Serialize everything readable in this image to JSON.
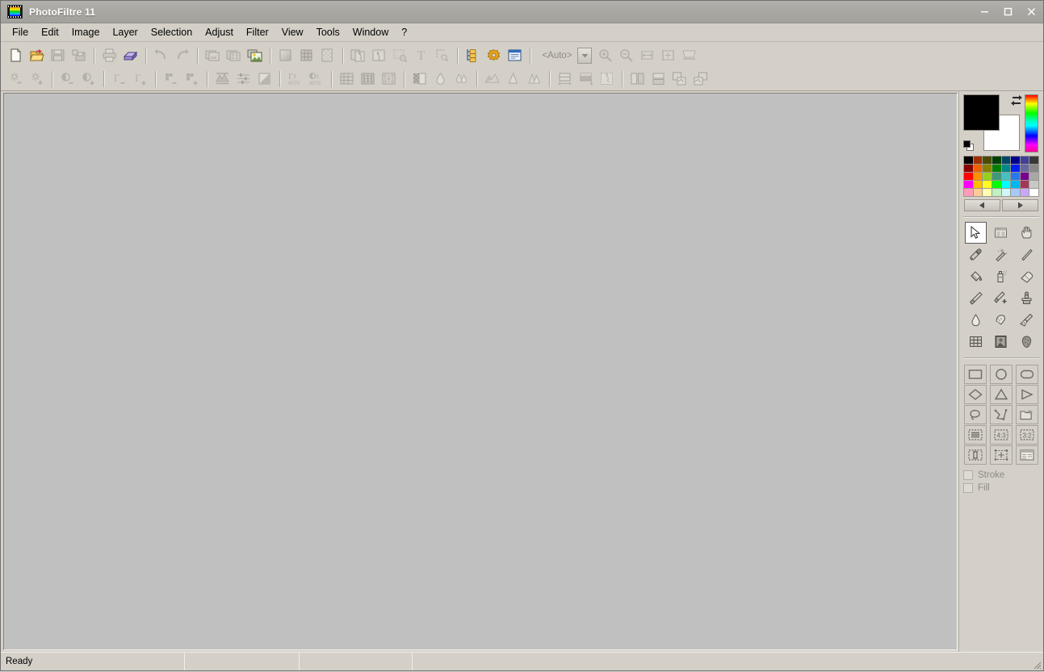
{
  "window": {
    "title": "PhotoFiltre 11",
    "app_icon": "filmstrip-icon",
    "minimize_label": "—",
    "maximize_label": "□",
    "close_label": "✕"
  },
  "menubar": {
    "items": [
      {
        "label": "File",
        "name": "menu-file"
      },
      {
        "label": "Edit",
        "name": "menu-edit"
      },
      {
        "label": "Image",
        "name": "menu-image"
      },
      {
        "label": "Layer",
        "name": "menu-layer"
      },
      {
        "label": "Selection",
        "name": "menu-selection"
      },
      {
        "label": "Adjust",
        "name": "menu-adjust"
      },
      {
        "label": "Filter",
        "name": "menu-filter"
      },
      {
        "label": "View",
        "name": "menu-view"
      },
      {
        "label": "Tools",
        "name": "menu-tools"
      },
      {
        "label": "Window",
        "name": "menu-window"
      },
      {
        "label": "?",
        "name": "menu-help"
      }
    ]
  },
  "toolbar_row1": {
    "zoom_value": "<Auto>",
    "buttons": [
      {
        "name": "new-icon",
        "title": "New",
        "enabled": true
      },
      {
        "name": "open-icon",
        "title": "Open",
        "enabled": true
      },
      {
        "name": "save-icon",
        "title": "Save",
        "enabled": false
      },
      {
        "name": "save-as-icon",
        "title": "Save As",
        "enabled": false
      },
      {
        "name": "sep"
      },
      {
        "name": "print-icon",
        "title": "Print",
        "enabled": false
      },
      {
        "name": "scanner-icon",
        "title": "Acquire / Scanner",
        "enabled": true
      },
      {
        "name": "sep"
      },
      {
        "name": "undo-icon",
        "title": "Undo",
        "enabled": false
      },
      {
        "name": "redo-icon",
        "title": "Redo",
        "enabled": false
      },
      {
        "name": "sep"
      },
      {
        "name": "batch-module-icon",
        "title": "Automation / Batch",
        "enabled": false
      },
      {
        "name": "contact-sheet-icon",
        "title": "Contact Sheet",
        "enabled": false
      },
      {
        "name": "image-explorer-icon",
        "title": "Image Explorer",
        "enabled": true
      },
      {
        "name": "sep"
      },
      {
        "name": "gradient-icon",
        "title": "Gradient",
        "enabled": false
      },
      {
        "name": "pattern-grid-icon",
        "title": "Pattern",
        "enabled": false
      },
      {
        "name": "transparency-icon",
        "title": "Transparent Color",
        "enabled": false
      },
      {
        "name": "sep"
      },
      {
        "name": "copy-layer-icon",
        "title": "Paste As Layer",
        "enabled": false
      },
      {
        "name": "layer-options-icon",
        "title": "Layer Options",
        "enabled": false
      },
      {
        "name": "selection-layer-icon",
        "title": "Selection To Layer",
        "enabled": false
      },
      {
        "name": "text-icon",
        "title": "Text",
        "enabled": false
      },
      {
        "name": "vector-selection-icon",
        "title": "Vector Selection",
        "enabled": false
      },
      {
        "name": "sep"
      },
      {
        "name": "folder-tree-icon",
        "title": "Folder Browser",
        "enabled": true
      },
      {
        "name": "plugin-gear-icon",
        "title": "Plugins",
        "enabled": true
      },
      {
        "name": "palette-window-icon",
        "title": "Tool Palette",
        "enabled": true
      },
      {
        "name": "sep"
      },
      {
        "name": "zoom-in-icon",
        "title": "Zoom In",
        "enabled": false
      },
      {
        "name": "zoom-out-icon",
        "title": "Zoom Out",
        "enabled": false
      },
      {
        "name": "fit-width-icon",
        "title": "Fit To Width",
        "enabled": false
      },
      {
        "name": "fit-screen-icon",
        "title": "Fit To Screen",
        "enabled": false
      },
      {
        "name": "full-screen-icon",
        "title": "Full Screen",
        "enabled": false
      }
    ]
  },
  "toolbar_row2": {
    "buttons": [
      {
        "name": "brightness-down-icon",
        "title": "Brightness -",
        "enabled": false
      },
      {
        "name": "brightness-up-icon",
        "title": "Brightness +",
        "enabled": false
      },
      {
        "name": "sep"
      },
      {
        "name": "contrast-down-icon",
        "title": "Contrast -",
        "enabled": false
      },
      {
        "name": "contrast-up-icon",
        "title": "Contrast +",
        "enabled": false
      },
      {
        "name": "sep"
      },
      {
        "name": "gamma-down-icon",
        "title": "Gamma -",
        "enabled": false
      },
      {
        "name": "gamma-up-icon",
        "title": "Gamma +",
        "enabled": false
      },
      {
        "name": "sep"
      },
      {
        "name": "saturation-down-icon",
        "title": "Saturation -",
        "enabled": false
      },
      {
        "name": "saturation-up-icon",
        "title": "Saturation +",
        "enabled": false
      },
      {
        "name": "sep"
      },
      {
        "name": "histogram-icon",
        "title": "Histogram",
        "enabled": false
      },
      {
        "name": "levels-icon",
        "title": "Levels",
        "enabled": false
      },
      {
        "name": "grayscale-icon",
        "title": "Grayscale",
        "enabled": false
      },
      {
        "name": "sep"
      },
      {
        "name": "auto-gamma-icon",
        "title": "Auto Gamma",
        "enabled": false
      },
      {
        "name": "auto-contrast-icon",
        "title": "Auto Contrast",
        "enabled": false
      },
      {
        "name": "sep"
      },
      {
        "name": "mosaic-icon",
        "title": "Mosaic",
        "enabled": false
      },
      {
        "name": "dots-icon",
        "title": "Dots",
        "enabled": false
      },
      {
        "name": "halftone-icon",
        "title": "Halftone",
        "enabled": false
      },
      {
        "name": "sep"
      },
      {
        "name": "contrast-mask-icon",
        "title": "Contrast Mask",
        "enabled": false
      },
      {
        "name": "blur-icon",
        "title": "Blur",
        "enabled": false
      },
      {
        "name": "blur-more-icon",
        "title": "Blur More",
        "enabled": false
      },
      {
        "name": "sep"
      },
      {
        "name": "relief-icon",
        "title": "Relief",
        "enabled": false
      },
      {
        "name": "sharpen-icon",
        "title": "Sharpen",
        "enabled": false
      },
      {
        "name": "sharpen-more-icon",
        "title": "Sharpen More",
        "enabled": false
      },
      {
        "name": "sep"
      },
      {
        "name": "image-size-icon",
        "title": "Image Size",
        "enabled": false
      },
      {
        "name": "canvas-size-icon",
        "title": "Canvas Size",
        "enabled": false
      },
      {
        "name": "frame-icon",
        "title": "Framing",
        "enabled": false
      },
      {
        "name": "sep"
      },
      {
        "name": "flip-horizontal-icon",
        "title": "Flip Horizontal",
        "enabled": false
      },
      {
        "name": "flip-vertical-icon",
        "title": "Flip Vertical",
        "enabled": false
      },
      {
        "name": "rotate-left-icon",
        "title": "Rotate Left",
        "enabled": false
      },
      {
        "name": "rotate-right-icon",
        "title": "Rotate Right",
        "enabled": false
      }
    ]
  },
  "color_panel": {
    "foreground": "#000000",
    "background": "#ffffff",
    "swap_icon": "swap-colors-icon",
    "reset_icon": "reset-colors-icon",
    "hue_strip": "hue-gradient-strip",
    "prev_label": "◀",
    "next_label": "▶",
    "palette": [
      "#000000",
      "#a03000",
      "#4a4a00",
      "#004000",
      "#004868",
      "#000090",
      "#404098",
      "#383838",
      "#880000",
      "#f06000",
      "#888000",
      "#008000",
      "#008888",
      "#0020f0",
      "#6868a0",
      "#888888",
      "#ff0000",
      "#ff9000",
      "#98d020",
      "#409878",
      "#48c0c0",
      "#2878e8",
      "#780090",
      "#a8a8a8",
      "#ff00ff",
      "#ffc000",
      "#ffff20",
      "#00ff00",
      "#00ffff",
      "#00b8f0",
      "#a03858",
      "#c8c8c8",
      "#ff9cb8",
      "#ffcc98",
      "#ffffb0",
      "#c0f0c0",
      "#d0f8f8",
      "#a8c8f8",
      "#c8a8f8",
      "#ffffff"
    ]
  },
  "tool_palette": {
    "active_index": 0,
    "tools": [
      {
        "name": "selection-arrow-tool",
        "label": "Selection"
      },
      {
        "name": "screen-capture-tool",
        "label": "Capture"
      },
      {
        "name": "hand-tool",
        "label": "Hand"
      },
      {
        "name": "eyedropper-tool",
        "label": "Color Picker"
      },
      {
        "name": "magic-wand-tool",
        "label": "Magic Wand"
      },
      {
        "name": "line-tool",
        "label": "Line"
      },
      {
        "name": "paint-bucket-tool",
        "label": "Fill"
      },
      {
        "name": "spray-tool",
        "label": "Airbrush"
      },
      {
        "name": "eraser-tool",
        "label": "Eraser"
      },
      {
        "name": "paintbrush-tool",
        "label": "Paintbrush"
      },
      {
        "name": "advanced-brush-tool",
        "label": "Advanced Brush"
      },
      {
        "name": "clone-stamp-tool",
        "label": "Clone Stamp"
      },
      {
        "name": "water-drop-tool",
        "label": "Blur / Drop"
      },
      {
        "name": "smudge-tool",
        "label": "Smudge"
      },
      {
        "name": "broom-tool",
        "label": "Sweep"
      },
      {
        "name": "grid-tool",
        "label": "Grid"
      },
      {
        "name": "picture-tool",
        "label": "Stamp Image"
      },
      {
        "name": "sponge-tool",
        "label": "Sponge"
      }
    ]
  },
  "shape_palette": {
    "shapes": [
      {
        "name": "rectangle-shape",
        "label": "Rectangle"
      },
      {
        "name": "ellipse-shape",
        "label": "Ellipse"
      },
      {
        "name": "rounded-rect-shape",
        "label": "Rounded Rectangle"
      },
      {
        "name": "diamond-shape",
        "label": "Diamond"
      },
      {
        "name": "triangle-shape",
        "label": "Triangle"
      },
      {
        "name": "right-triangle-shape",
        "label": "Right Triangle"
      },
      {
        "name": "lasso-shape",
        "label": "Lasso"
      },
      {
        "name": "polygon-shape",
        "label": "Polygon"
      },
      {
        "name": "load-selection-shape",
        "label": "Load Selection"
      },
      {
        "name": "lines-selection-shape",
        "label": "Lines"
      },
      {
        "name": "ratio-4-3-shape",
        "label": "4:3"
      },
      {
        "name": "ratio-3-2-shape",
        "label": "3:2"
      },
      {
        "name": "vertical-ratio-shape",
        "label": "Vertical"
      },
      {
        "name": "transform-shape",
        "label": "Transform"
      },
      {
        "name": "selection-options-shape",
        "label": "Options"
      }
    ],
    "ratio_4_3_label": "4:3",
    "ratio_3_2_label": "3:2"
  },
  "draw_options": {
    "stroke_label": "Stroke",
    "stroke_checked": false,
    "fill_label": "Fill",
    "fill_checked": false
  },
  "statusbar": {
    "message": "Ready",
    "cell1": "",
    "cell2": "",
    "cell3": "",
    "grip": "resize-grip-icon"
  }
}
